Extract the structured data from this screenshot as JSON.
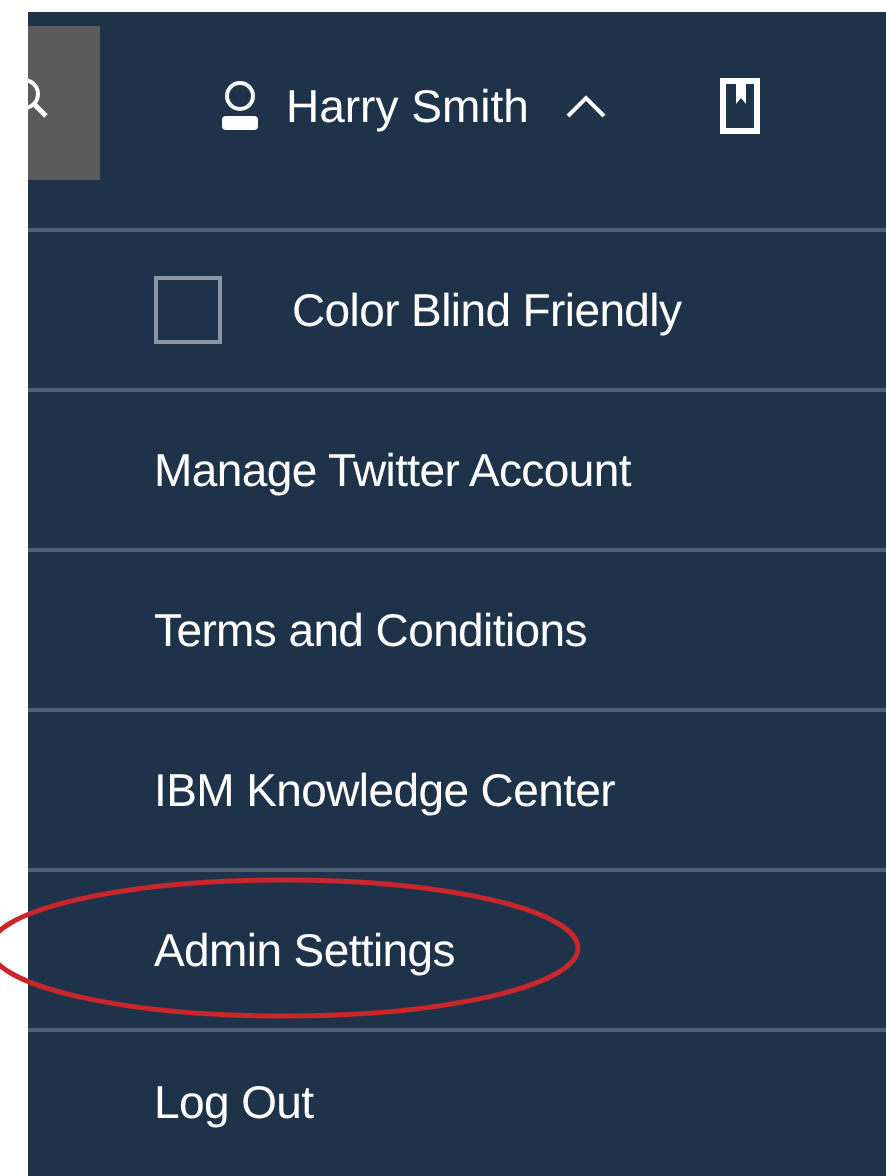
{
  "header": {
    "user_name": "Harry Smith",
    "expanded": true
  },
  "menu": [
    {
      "kind": "checkbox",
      "label": "Color Blind Friendly",
      "checked": false,
      "circled": false
    },
    {
      "kind": "link",
      "label": "Manage Twitter Account",
      "circled": false
    },
    {
      "kind": "link",
      "label": "Terms and Conditions",
      "circled": false
    },
    {
      "kind": "link",
      "label": "IBM Knowledge Center",
      "circled": false
    },
    {
      "kind": "link",
      "label": "Admin Settings",
      "circled": true
    },
    {
      "kind": "link",
      "label": "Log Out",
      "circled": false
    }
  ]
}
